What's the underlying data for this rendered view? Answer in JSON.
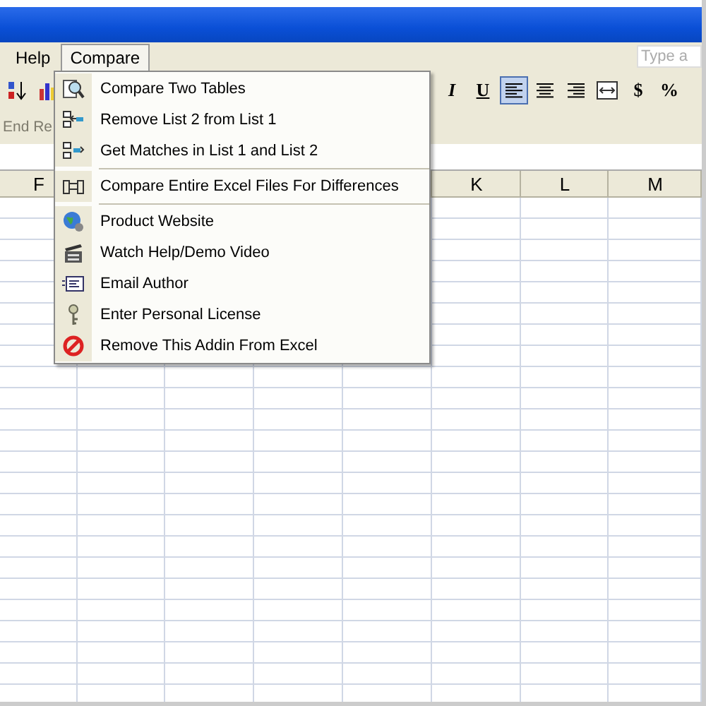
{
  "menubar": [
    {
      "label": "Help",
      "selected": false
    },
    {
      "label": "Compare",
      "selected": true
    }
  ],
  "help_field": {
    "placeholder": "Type a"
  },
  "toolbar": [
    {
      "kind": "sort",
      "selected": false
    },
    {
      "kind": "chart",
      "selected": false
    },
    {
      "kind": "italic",
      "label": "I",
      "selected": false
    },
    {
      "kind": "underline",
      "label": "U",
      "selected": false
    },
    {
      "kind": "align-left",
      "selected": true
    },
    {
      "kind": "align-center",
      "selected": false
    },
    {
      "kind": "align-right",
      "selected": false
    },
    {
      "kind": "merge",
      "selected": false
    },
    {
      "kind": "currency",
      "label": "$",
      "selected": false
    },
    {
      "kind": "percent",
      "label": "%",
      "selected": false
    }
  ],
  "review_bar": {
    "label": "End Re",
    "disabled": true
  },
  "column_headers": [
    "F",
    "K",
    "L",
    "M"
  ],
  "menu": {
    "items": [
      {
        "label": "Compare Two Tables",
        "kind": "magnifier",
        "separator_before": false
      },
      {
        "label": "Remove List 2 from List 1",
        "kind": "list-left",
        "separator_before": false
      },
      {
        "label": "Get Matches in List 1 and List 2",
        "kind": "list-right",
        "separator_before": false
      },
      {
        "label": "Compare Entire Excel Files For Differences",
        "kind": "files",
        "separator_before": true
      },
      {
        "label": "Product Website",
        "kind": "globe",
        "separator_before": true
      },
      {
        "label": "Watch Help/Demo Video",
        "kind": "clapper",
        "separator_before": false
      },
      {
        "label": "Email Author",
        "kind": "mail",
        "separator_before": false
      },
      {
        "label": "Enter Personal License",
        "kind": "key",
        "separator_before": false
      },
      {
        "label": "Remove This Addin From Excel",
        "kind": "forbidden",
        "separator_before": false
      }
    ]
  }
}
